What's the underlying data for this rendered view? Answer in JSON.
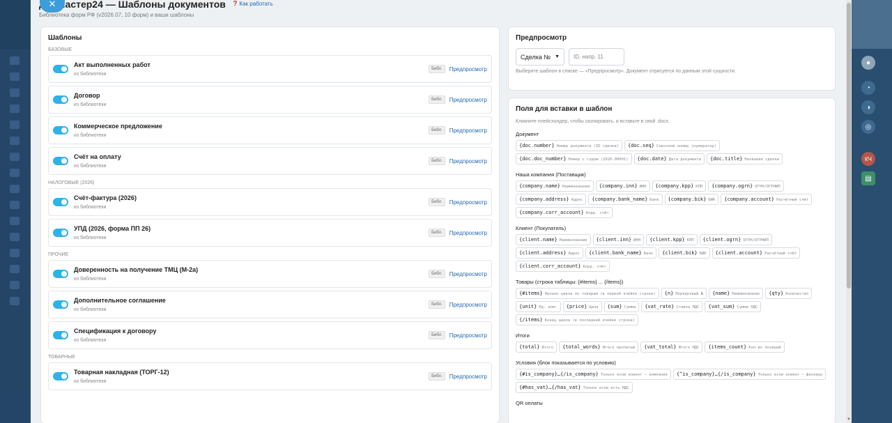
{
  "header": {
    "title": "ДокМастер24 — Шаблоны документов",
    "help_label": "Как работать",
    "subtitle": "Библиотека форм РФ (v2026.07, 10 форм) и ваши шаблоны"
  },
  "templates": {
    "title": "Шаблоны",
    "badge": "Библ.",
    "preview_label": "Предпросмотр",
    "groups": [
      {
        "label": "БАЗОВЫЕ",
        "items": [
          {
            "name": "Акт выполненных работ",
            "source": "из библиотеки"
          },
          {
            "name": "Договор",
            "source": "из библиотеки"
          },
          {
            "name": "Коммерческое предложение",
            "source": "из библиотеки"
          },
          {
            "name": "Счёт на оплату",
            "source": "из библиотеки"
          }
        ]
      },
      {
        "label": "НАЛОГОВЫЕ (2026)",
        "items": [
          {
            "name": "Счёт-фактура (2026)",
            "source": "из библиотеки"
          },
          {
            "name": "УПД (2026, форма ПП 26)",
            "source": "из библиотеки"
          }
        ]
      },
      {
        "label": "ПРОЧИЕ",
        "items": [
          {
            "name": "Доверенность на получение ТМЦ (М-2а)",
            "source": "из библиотеки"
          },
          {
            "name": "Дополнительное соглашение",
            "source": "из библиотеки"
          },
          {
            "name": "Спецификация к договору",
            "source": "из библиотеки"
          }
        ]
      },
      {
        "label": "ТОВАРНЫЕ",
        "items": [
          {
            "name": "Товарная накладная (ТОРГ-12)",
            "source": "из библиотеки"
          }
        ]
      }
    ]
  },
  "preview": {
    "title": "Предпросмотр",
    "select_value": "Сделка №",
    "id_placeholder": "ID, напр. 11",
    "hint": "Выберите шаблон в списке — «Предпросмотр». Документ отрисуется по данным этой сущности."
  },
  "fields": {
    "title": "Поля для вставки в шаблон",
    "hint": "Кликните плейсхолдер, чтобы скопировать, и вставьте в свой .docx.",
    "sections": [
      {
        "title": "Документ",
        "chips": [
          {
            "code": "{doc.number}",
            "desc": "Номер документа (ID сделки)"
          },
          {
            "code": "{doc.seq}",
            "desc": "Сквозной номер (нумератор)"
          },
          {
            "code": "{doc.doc_number}",
            "desc": "Номер с годом (2026-00001)"
          },
          {
            "code": "{doc.date}",
            "desc": "Дата документа"
          },
          {
            "code": "{doc.title}",
            "desc": "Название сделки"
          }
        ]
      },
      {
        "title": "Наша компания (Поставщик)",
        "chips": [
          {
            "code": "{company.name}",
            "desc": "Наименование"
          },
          {
            "code": "{company.inn}",
            "desc": "ИНН"
          },
          {
            "code": "{company.kpp}",
            "desc": "КПП"
          },
          {
            "code": "{company.ogrn}",
            "desc": "ОГРН/ОГРНИП"
          },
          {
            "code": "{company.address}",
            "desc": "Адрес"
          },
          {
            "code": "{company.bank_name}",
            "desc": "Банк"
          },
          {
            "code": "{company.bik}",
            "desc": "БИК"
          },
          {
            "code": "{company.account}",
            "desc": "Расчётный счёт"
          },
          {
            "code": "{company.corr_account}",
            "desc": "Корр. счёт"
          }
        ]
      },
      {
        "title": "Клиент (Покупатель)",
        "chips": [
          {
            "code": "{client.name}",
            "desc": "Наименование"
          },
          {
            "code": "{client.inn}",
            "desc": "ИНН"
          },
          {
            "code": "{client.kpp}",
            "desc": "КПП"
          },
          {
            "code": "{client.ogrn}",
            "desc": "ОГРН/ОГРНИП"
          },
          {
            "code": "{client.address}",
            "desc": "Адрес"
          },
          {
            "code": "{client.bank_name}",
            "desc": "Банк"
          },
          {
            "code": "{client.bik}",
            "desc": "БИК"
          },
          {
            "code": "{client.account}",
            "desc": "Расчётный счёт"
          },
          {
            "code": "{client.corr_account}",
            "desc": "Корр. счёт"
          }
        ]
      },
      {
        "title": "Товары (строка таблицы: {#items} ... {/items})",
        "chips": [
          {
            "code": "{#items}",
            "desc": "Начало цикла по товарам (в первой ячейке строки)"
          },
          {
            "code": "{n}",
            "desc": "Порядковый №"
          },
          {
            "code": "{name}",
            "desc": "Наименование"
          },
          {
            "code": "{qty}",
            "desc": "Количество"
          },
          {
            "code": "{unit}",
            "desc": "Ед. изм."
          },
          {
            "code": "{price}",
            "desc": "Цена"
          },
          {
            "code": "{sum}",
            "desc": "Сумма"
          },
          {
            "code": "{vat_rate}",
            "desc": "Ставка НДС"
          },
          {
            "code": "{vat_sum}",
            "desc": "Сумма НДС"
          },
          {
            "code": "{/items}",
            "desc": "Конец цикла (в последней ячейке строки)"
          }
        ]
      },
      {
        "title": "Итоги",
        "chips": [
          {
            "code": "{total}",
            "desc": "Итого"
          },
          {
            "code": "{total_words}",
            "desc": "Итого прописью"
          },
          {
            "code": "{vat_total}",
            "desc": "Итого НДС"
          },
          {
            "code": "{items_count}",
            "desc": "Кол-во позиций"
          }
        ]
      },
      {
        "title": "Условия (блок показывается по условию)",
        "chips": [
          {
            "code": "{#is_company}…{/is_company}",
            "desc": "Только если клиент — компания"
          },
          {
            "code": "{^is_company}…{/is_company}",
            "desc": "Только если клиент — физлицо"
          },
          {
            "code": "{#has_vat}…{/has_vat}",
            "desc": "Только если есть НДС"
          }
        ]
      },
      {
        "title": "QR оплаты",
        "chips": []
      }
    ]
  },
  "rail": {
    "avatar_initials": "КЧ"
  },
  "colors": {
    "accent": "#2fb2e8",
    "link": "#2067b0",
    "close": "#3b9edb"
  }
}
